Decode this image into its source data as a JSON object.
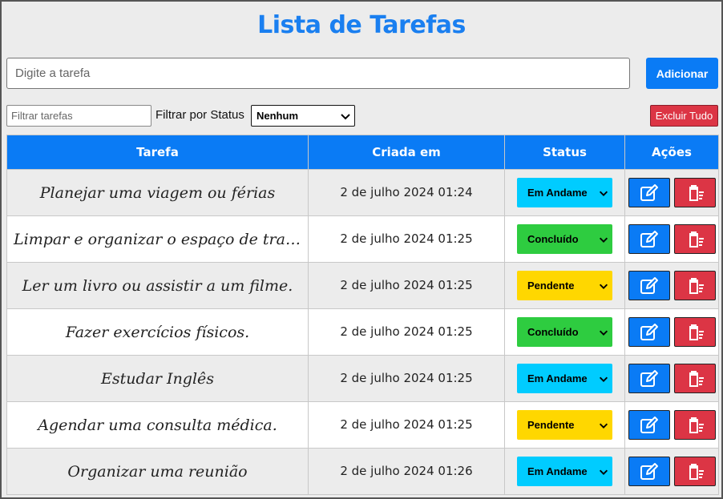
{
  "header": {
    "title": "Lista de Tarefas"
  },
  "task_input": {
    "placeholder": "Digite a tarefa",
    "value": ""
  },
  "add_button": {
    "label": "Adicionar"
  },
  "filter": {
    "placeholder": "Filtrar tarefas",
    "value": "",
    "status_label": "Filtrar por Status",
    "status_selected": "Nenhum"
  },
  "delete_all": {
    "label": "Excluir Tudo"
  },
  "table": {
    "headers": [
      "Tarefa",
      "Criada em",
      "Status",
      "Ações"
    ],
    "rows": [
      {
        "task": "Planejar uma viagem ou férias",
        "created": "2 de julho 2024 01:24",
        "status": "Em Andame",
        "status_color": "#00ccff"
      },
      {
        "task": "Limpar e organizar o espaço de trabalh...",
        "created": "2 de julho 2024 01:25",
        "status": "Concluído",
        "status_color": "#2ecc40"
      },
      {
        "task": "Ler um livro ou assistir a um filme.",
        "created": "2 de julho 2024 01:25",
        "status": "Pendente",
        "status_color": "#ffd700"
      },
      {
        "task": "Fazer exercícios físicos.",
        "created": "2 de julho 2024 01:25",
        "status": "Concluído",
        "status_color": "#2ecc40"
      },
      {
        "task": "Estudar Inglês",
        "created": "2 de julho 2024 01:25",
        "status": "Em Andame",
        "status_color": "#00ccff"
      },
      {
        "task": "Agendar uma consulta médica.",
        "created": "2 de julho 2024 01:25",
        "status": "Pendente",
        "status_color": "#ffd700"
      },
      {
        "task": "Organizar uma reunião",
        "created": "2 de julho 2024 01:26",
        "status": "Em Andame",
        "status_color": "#00ccff"
      }
    ]
  },
  "icons": {
    "edit": "edit-icon",
    "delete": "trash-icon",
    "dropdown": "chevron-down-icon"
  },
  "colors": {
    "accent": "#0a7bf5",
    "title": "#1a7ff0",
    "danger": "#dc3545",
    "status_em_andamento": "#00ccff",
    "status_concluido": "#2ecc40",
    "status_pendente": "#ffd700"
  }
}
